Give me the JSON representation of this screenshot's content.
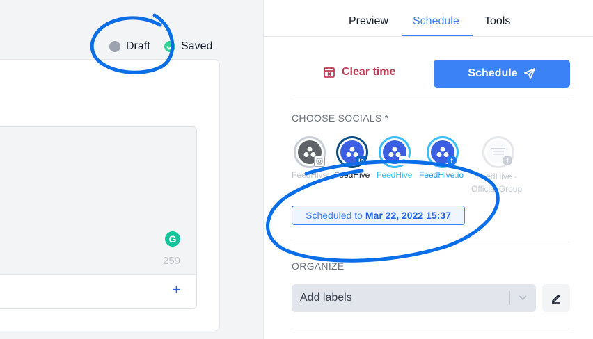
{
  "editor": {
    "status_draft": "Draft",
    "status_saved": "Saved",
    "char_count": "259",
    "grammarly_icon_letter": "G"
  },
  "tabs": [
    {
      "label": "Preview",
      "active": false
    },
    {
      "label": "Schedule",
      "active": true
    },
    {
      "label": "Tools",
      "active": false
    }
  ],
  "actions": {
    "clear_time_label": "Clear time",
    "schedule_label": "Schedule"
  },
  "socials": {
    "section_label": "CHOOSE SOCIALS *",
    "accounts": [
      {
        "name": "FeedHive",
        "network": "instagram",
        "selected": false
      },
      {
        "name": "FeedHive",
        "network": "linkedin",
        "selected": true
      },
      {
        "name": "FeedHive",
        "network": "twitter",
        "selected": true
      },
      {
        "name": "FeedHive.io",
        "network": "facebook",
        "selected": true
      },
      {
        "name": "FeedHive - Official Group",
        "name_line1": "FeedHive -",
        "name_line2": "Official Group",
        "network": "facebook",
        "selected": false
      }
    ]
  },
  "schedule": {
    "prefix": "Scheduled to",
    "datetime": "Mar 22, 2022 15:37"
  },
  "organize": {
    "section_label": "ORGANIZE",
    "labels_placeholder": "Add labels"
  },
  "colors": {
    "accent": "#3b82f6",
    "danger": "#be3c55",
    "annotation": "#0a6ee8"
  }
}
